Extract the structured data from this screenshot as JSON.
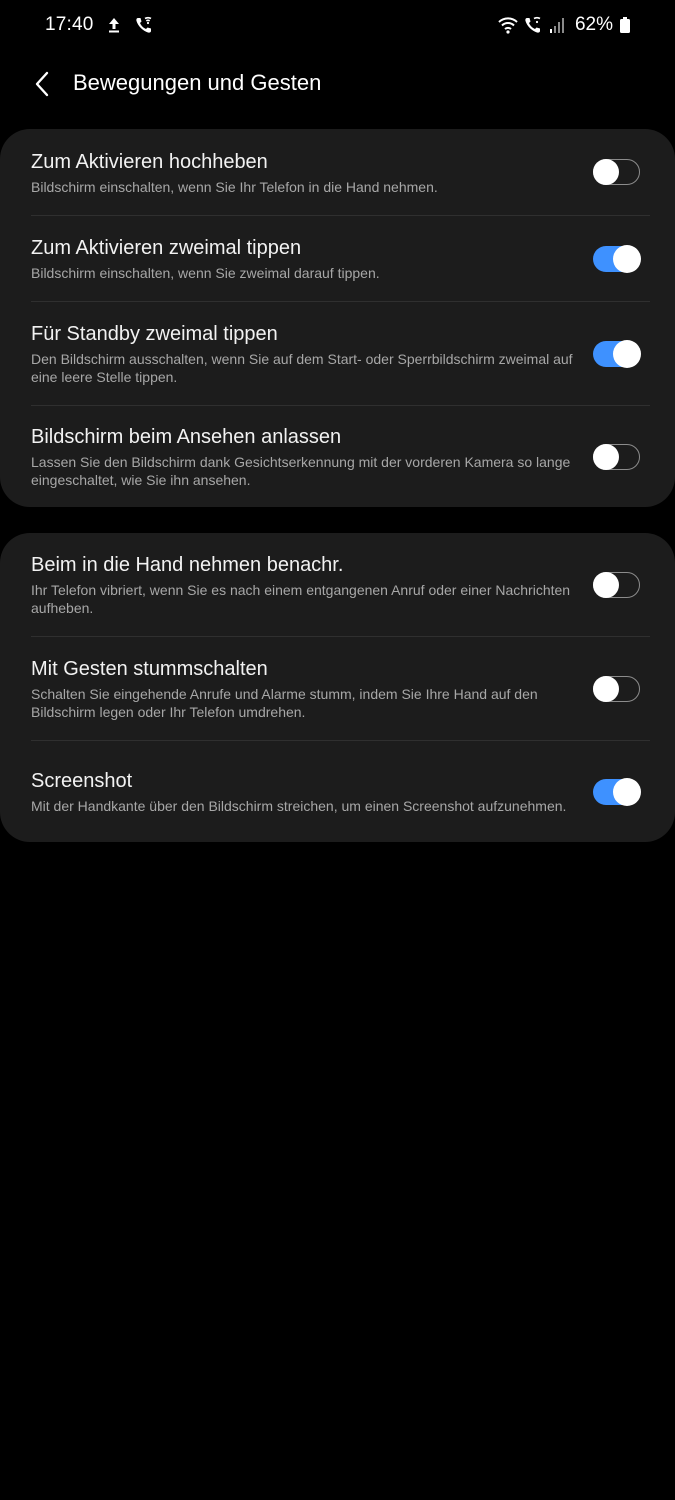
{
  "status_bar": {
    "time": "17:40",
    "battery": "62%",
    "left_icons": [
      "upload-icon",
      "wifi-call-icon"
    ],
    "right_icons": [
      "wifi-icon",
      "wifi-call-icon",
      "signal-icon",
      "battery-icon"
    ]
  },
  "header": {
    "back_icon": "back-arrow-icon",
    "title": "Bewegungen und Gesten"
  },
  "colors": {
    "background": "#000000",
    "card": "#1c1c1c",
    "toggle_on": "#3e91ff"
  },
  "group1": [
    {
      "title": "Zum Aktivieren hochheben",
      "subtitle": "Bildschirm einschalten, wenn Sie Ihr Telefon in die Hand nehmen.",
      "enabled": false
    },
    {
      "title": "Zum Aktivieren zweimal tippen",
      "subtitle": "Bildschirm einschalten, wenn Sie zweimal darauf tippen.",
      "enabled": true
    },
    {
      "title": "Für Standby zweimal tippen",
      "subtitle": "Den Bildschirm ausschalten, wenn Sie auf dem Start- oder Sperrbildschirm zweimal auf eine leere Stelle tippen.",
      "enabled": true
    },
    {
      "title": "Bildschirm beim Ansehen anlassen",
      "subtitle": "Lassen Sie den Bildschirm dank Gesichtserkennung mit der vorderen Kamera so lange eingeschaltet, wie Sie ihn ansehen.",
      "enabled": false
    }
  ],
  "group2": [
    {
      "title": "Beim in die Hand nehmen benachr.",
      "subtitle": "Ihr Telefon vibriert, wenn Sie es nach einem entgangenen Anruf oder einer Nachrichten aufheben.",
      "enabled": false
    },
    {
      "title": "Mit Gesten stummschalten",
      "subtitle": "Schalten Sie eingehende Anrufe und Alarme stumm, indem Sie Ihre Hand auf den Bildschirm legen oder Ihr Telefon umdrehen.",
      "enabled": false
    },
    {
      "title": "Screenshot",
      "subtitle": "Mit der Handkante über den Bildschirm streichen, um einen Screenshot aufzunehmen.",
      "enabled": true
    }
  ]
}
